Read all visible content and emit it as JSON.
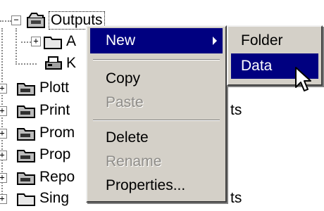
{
  "tree": {
    "root_label": "Outputs",
    "children": [
      {
        "label": "A",
        "expander": "+"
      },
      {
        "label": "K",
        "expander": ""
      }
    ],
    "siblings": [
      {
        "label": "Plott",
        "expander": "+"
      },
      {
        "label": "Print",
        "expander": "+",
        "trailing": "ts"
      },
      {
        "label": "Prom",
        "expander": "+"
      },
      {
        "label": "Prop",
        "expander": "+"
      },
      {
        "label": "Repo",
        "expander": "+"
      },
      {
        "label": "Sing",
        "expander": "+",
        "trailing": "ts"
      }
    ]
  },
  "context_menu": {
    "items": [
      {
        "label": "New",
        "state": "highlighted",
        "has_submenu": true
      },
      {
        "label": "Copy",
        "state": "enabled"
      },
      {
        "label": "Paste",
        "state": "disabled"
      },
      {
        "label": "Delete",
        "state": "enabled"
      },
      {
        "label": "Rename",
        "state": "disabled"
      },
      {
        "label": "Properties...",
        "state": "enabled"
      }
    ]
  },
  "submenu": {
    "items": [
      {
        "label": "Folder",
        "state": "enabled"
      },
      {
        "label": "Data",
        "state": "highlighted"
      }
    ]
  },
  "colors": {
    "menu_bg": "#d4d0c8",
    "highlight_bg": "#000080",
    "highlight_text": "#ffffff",
    "disabled_text": "#8e8c88"
  }
}
